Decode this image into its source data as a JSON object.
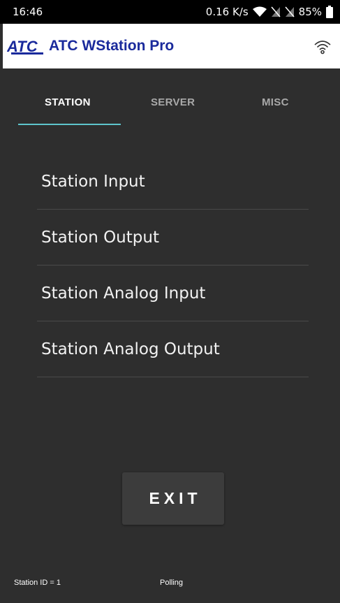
{
  "status_bar": {
    "time": "16:46",
    "network_speed": "0.16 K/s",
    "battery": "85%",
    "icons": [
      "wifi-signal-icon",
      "no-sim-icon",
      "no-sim-icon",
      "battery-icon"
    ]
  },
  "app_bar": {
    "logo_text": "ATC",
    "title": "ATC WStation Pro",
    "connection_icon": "wifi-icon"
  },
  "tabs": [
    {
      "label": "STATION",
      "active": true
    },
    {
      "label": "SERVER",
      "active": false
    },
    {
      "label": "MISC",
      "active": false
    }
  ],
  "menu": {
    "items": [
      {
        "label": "Station Input"
      },
      {
        "label": "Station Output"
      },
      {
        "label": "Station Analog Input"
      },
      {
        "label": "Station Analog Output"
      }
    ]
  },
  "exit_button": {
    "label": "EXIT"
  },
  "footer": {
    "station_id": "Station ID = 1",
    "status": "Polling"
  },
  "colors": {
    "background": "#2e2e2e",
    "accent": "#5ec5cc",
    "brand": "#1a2a9c"
  }
}
